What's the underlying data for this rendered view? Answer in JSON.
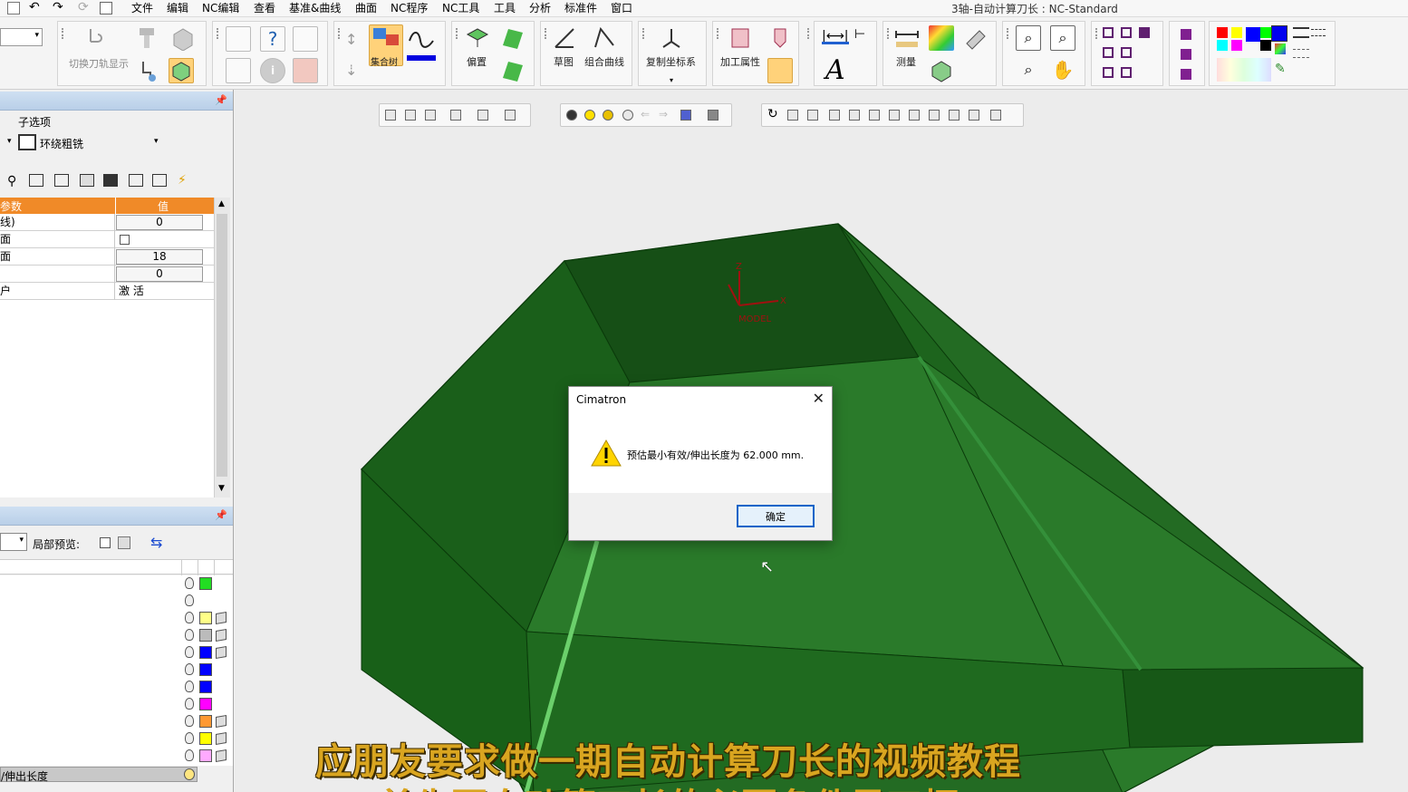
{
  "window": {
    "title": "3轴-自动计算刀长 : NC-Standard"
  },
  "menu": {
    "items": [
      "文件",
      "编辑",
      "NC编辑",
      "查看",
      "基准&曲线",
      "曲面",
      "NC程序",
      "NC工具",
      "工具",
      "分析",
      "标准件",
      "窗口"
    ]
  },
  "ribbon": {
    "labels": {
      "switch_path": "切换刀轨显示",
      "tree": "集合树",
      "offset": "偏置",
      "sketch": "草图",
      "combo_curve": "组合曲线",
      "copy_ucs": "复制坐标系",
      "machining_attr": "加工属性",
      "measure": "测量"
    },
    "palette": [
      "#ff0000",
      "#ffff00",
      "#00ff00",
      "#00ffff",
      "#0000ff",
      "#00ffff",
      "#ff00ff",
      "#ffffff",
      "#000000",
      "#808080"
    ]
  },
  "left_panel": {
    "sub_option_label": "子选项",
    "procedure": "环绕粗铣",
    "grid": {
      "header": {
        "param": "参数",
        "value": "值"
      },
      "rows": [
        {
          "name": "线)",
          "value": "0"
        },
        {
          "name": "面",
          "value": ""
        },
        {
          "name": "面",
          "value": "18"
        },
        {
          "name": "",
          "value": "0"
        },
        {
          "name": "户",
          "value": "激 活"
        }
      ]
    },
    "preview_label": "局部预览:",
    "layer_colors": [
      "#22dd22",
      "",
      "#ffff88",
      "#bbbbbb",
      "#0000ff",
      "#0000ff",
      "#0000ff",
      "#ff00ff",
      "#ff9933",
      "#ffff00",
      "#ffaaff"
    ],
    "bottom_label": "/伸出长度"
  },
  "viewport": {
    "axis_labels": {
      "z": "Z",
      "x": "X",
      "model": "MODEL"
    },
    "model_color": "#1f6b1f"
  },
  "dialog": {
    "title": "Cimatron",
    "close": "✕",
    "message": "预估最小有效/伸出长度为 62.000 mm.",
    "ok": "确定"
  },
  "subtitle": {
    "line1": "应朋友要求做一期自动计算刀长的视频教程",
    "line2": "首先要自动算刀长的必要条件是刀柄"
  }
}
